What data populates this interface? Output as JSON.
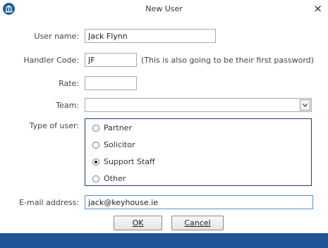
{
  "window": {
    "title": "New User",
    "close_glyph": "×"
  },
  "form": {
    "user_name": {
      "label": "User name:",
      "value": "Jack Flynn"
    },
    "handler_code": {
      "label": "Handler Code:",
      "value": "JF",
      "note": "(This is also going to be their first password)"
    },
    "rate": {
      "label": "Rate:",
      "value": ""
    },
    "team": {
      "label": "Team:",
      "value": ""
    },
    "user_type": {
      "label": "Type of user:",
      "options": [
        "Partner",
        "Solicitor",
        "Support Staff",
        "Other"
      ],
      "selected": "Support Staff"
    },
    "email": {
      "label": "E-mail address:",
      "value": "jack@keyhouse.ie"
    }
  },
  "buttons": {
    "ok": "OK",
    "cancel": "Cancel"
  },
  "icons": {
    "app": "courthouse-icon",
    "close": "close-icon",
    "dropdown": "chevron-down-icon"
  },
  "colors": {
    "accent": "#1f5597",
    "group_border": "#1f3e7a",
    "focus_border": "#5b91d6"
  }
}
